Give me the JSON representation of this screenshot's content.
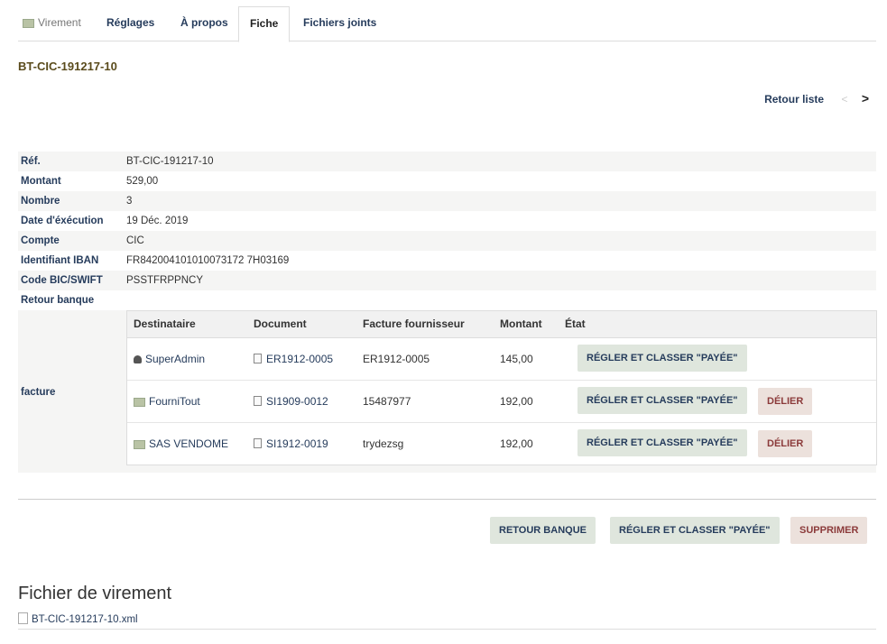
{
  "tabs": [
    {
      "label": "Virement"
    },
    {
      "label": "Réglages"
    },
    {
      "label": "À propos"
    },
    {
      "label": "Fiche"
    },
    {
      "label": "Fichiers joints"
    }
  ],
  "ref_title": "BT-CIC-191217-10",
  "nav": {
    "back": "Retour liste",
    "prev": "<",
    "next": ">"
  },
  "fields": [
    {
      "label": "Réf.",
      "value": "BT-CIC-191217-10"
    },
    {
      "label": "Montant",
      "value": "529,00"
    },
    {
      "label": "Nombre",
      "value": "3"
    },
    {
      "label": "Date d'éxécution",
      "value": "19 Déc. 2019"
    },
    {
      "label": "Compte",
      "value": "CIC"
    },
    {
      "label": "Identifiant IBAN",
      "value": "FR842004101010073172 7H03169"
    },
    {
      "label": "Code BIC/SWIFT",
      "value": "PSSTFRPPNCY"
    },
    {
      "label": "Retour banque",
      "value": ""
    }
  ],
  "facture_label": "facture",
  "invoices": {
    "headers": [
      "Destinataire",
      "Document",
      "Facture fournisseur",
      "Montant",
      "État"
    ],
    "rows": [
      {
        "dest": "SuperAdmin",
        "dest_icon": "user-icon",
        "doc": "ER1912-0005",
        "supplier_invoice": "ER1912-0005",
        "amount": "145,00",
        "pay_label": "Régler et classer \"Payée\"",
        "unlink_label": ""
      },
      {
        "dest": "FourniTout",
        "dest_icon": "company-icon",
        "doc": "SI1909-0012",
        "supplier_invoice": "15487977",
        "amount": "192,00",
        "pay_label": "Régler et classer \"Payée\"",
        "unlink_label": "Délier"
      },
      {
        "dest": "SAS VENDOME",
        "dest_icon": "company-icon",
        "doc": "SI1912-0019",
        "supplier_invoice": "trydezsg",
        "amount": "192,00",
        "pay_label": "Régler et classer \"Payée\"",
        "unlink_label": "Délier"
      }
    ]
  },
  "actions": {
    "bank_return": "Retour banque",
    "pay": "Régler et classer \"Payée\"",
    "delete": "Supprimer"
  },
  "files_section": {
    "title": "Fichier de virement",
    "file": "BT-CIC-191217-10.xml"
  }
}
